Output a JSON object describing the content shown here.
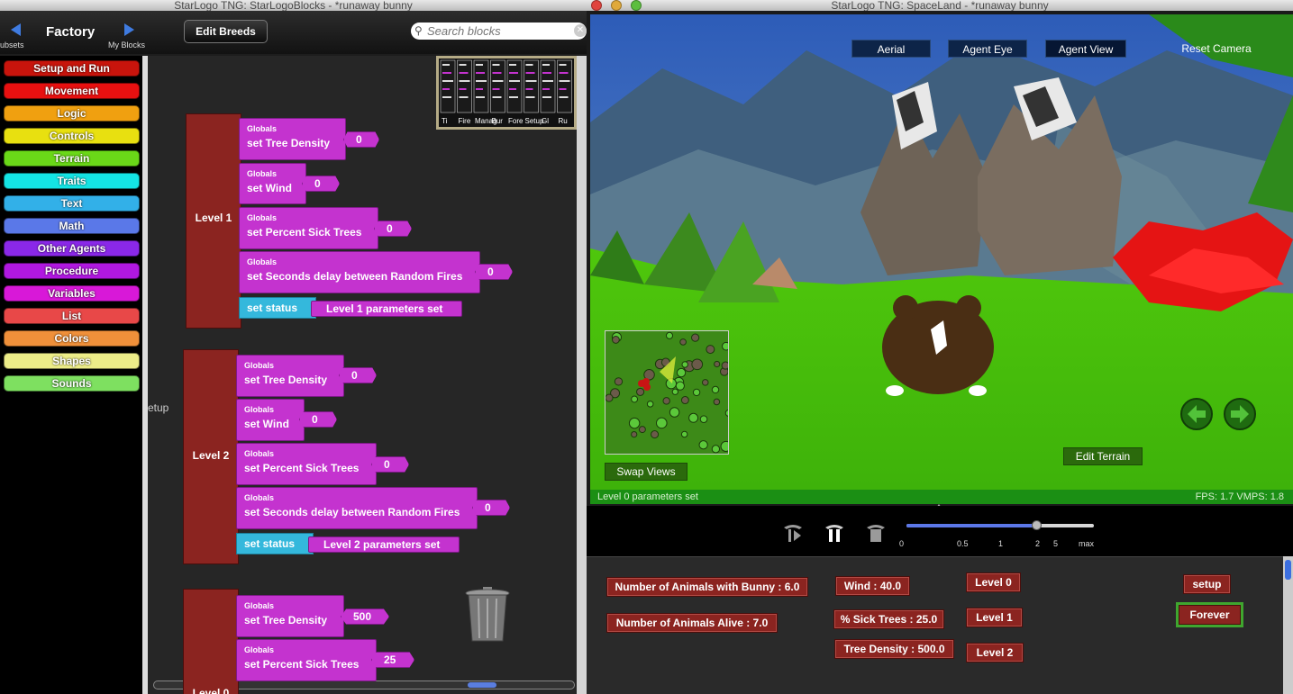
{
  "left_window": {
    "title": "StarLogo TNG: StarLogoBlocks - *runaway bunny",
    "toolbar": {
      "subsets_label": "ubsets",
      "factory_title": "Factory",
      "my_blocks_label": "My Blocks",
      "edit_breeds_label": "Edit Breeds",
      "search_placeholder": "Search blocks"
    },
    "categories": [
      {
        "label": "Setup and Run",
        "color": "#c8140c"
      },
      {
        "label": "Movement",
        "color": "#e81010"
      },
      {
        "label": "Logic",
        "color": "#f0a010"
      },
      {
        "label": "Controls",
        "color": "#e8e010"
      },
      {
        "label": "Terrain",
        "color": "#6ad818"
      },
      {
        "label": "Traits",
        "color": "#14e4e4"
      },
      {
        "label": "Text",
        "color": "#32b0e8"
      },
      {
        "label": "Math",
        "color": "#5a78e8"
      },
      {
        "label": "Other Agents",
        "color": "#8a28e8"
      },
      {
        "label": "Procedure",
        "color": "#b018e0"
      },
      {
        "label": "Variables",
        "color": "#d818d8"
      },
      {
        "label": "List",
        "color": "#e84848"
      },
      {
        "label": "Colors",
        "color": "#f0903a"
      },
      {
        "label": "Shapes",
        "color": "#ecec88"
      },
      {
        "label": "Sounds",
        "color": "#7ee060"
      }
    ],
    "minimap_labels": [
      "Ti",
      "Fire",
      "Manag",
      "Bur",
      "Fore",
      "Setup",
      "Gl",
      "Ru"
    ],
    "workspace": {
      "setup_label": "etup",
      "groups": [
        {
          "level_label": "Level 1",
          "globals_label": "Globals",
          "rows": [
            {
              "set_label": "set Tree Density",
              "value": "0"
            },
            {
              "set_label": "set Wind",
              "value": "0"
            },
            {
              "set_label": "set Percent Sick Trees",
              "value": "0"
            },
            {
              "set_label": "set Seconds delay between  Random Fires",
              "value": "0"
            }
          ],
          "status_label": "set status",
          "status_value": "Level 1 parameters set"
        },
        {
          "level_label": "Level 2",
          "globals_label": "Globals",
          "rows": [
            {
              "set_label": "set Tree Density",
              "value": "0"
            },
            {
              "set_label": "set Wind",
              "value": "0"
            },
            {
              "set_label": "set Percent Sick Trees",
              "value": "0"
            },
            {
              "set_label": "set Seconds delay between  Random Fires",
              "value": "0"
            }
          ],
          "status_label": "set status",
          "status_value": "Level 2 parameters set"
        },
        {
          "level_label": "Level 0",
          "globals_label": "Globals",
          "rows": [
            {
              "set_label": "set Tree Density",
              "value": "500"
            },
            {
              "set_label": "set Percent Sick Trees",
              "value": "25"
            }
          ]
        }
      ]
    }
  },
  "right_window": {
    "title": "StarLogo TNG: SpaceLand - *runaway bunny",
    "view_buttons": [
      "Aerial",
      "Agent Eye",
      "Agent View"
    ],
    "reset_camera_label": "Reset Camera",
    "swap_views_label": "Swap Views",
    "edit_terrain_label": "Edit Terrain",
    "status_message": "Level 0 parameters set",
    "fps_readout": "FPS: 1.7   VMPS: 1.8",
    "speed_ticks": [
      "0",
      "0.5",
      "1",
      "2",
      "5",
      "max"
    ],
    "speed_level": 0.69,
    "monitors": {
      "animals_with_bunny": "Number of Animals with Bunny : 6.0",
      "animals_alive": "Number of Animals Alive : 7.0",
      "wind": "Wind : 40.0",
      "sick_trees": "% Sick Trees : 25.0",
      "tree_density": "Tree Density : 500.0"
    },
    "level_buttons": [
      "Level 0",
      "Level 1",
      "Level 2"
    ],
    "setup_label": "setup",
    "forever_label": "Forever"
  }
}
